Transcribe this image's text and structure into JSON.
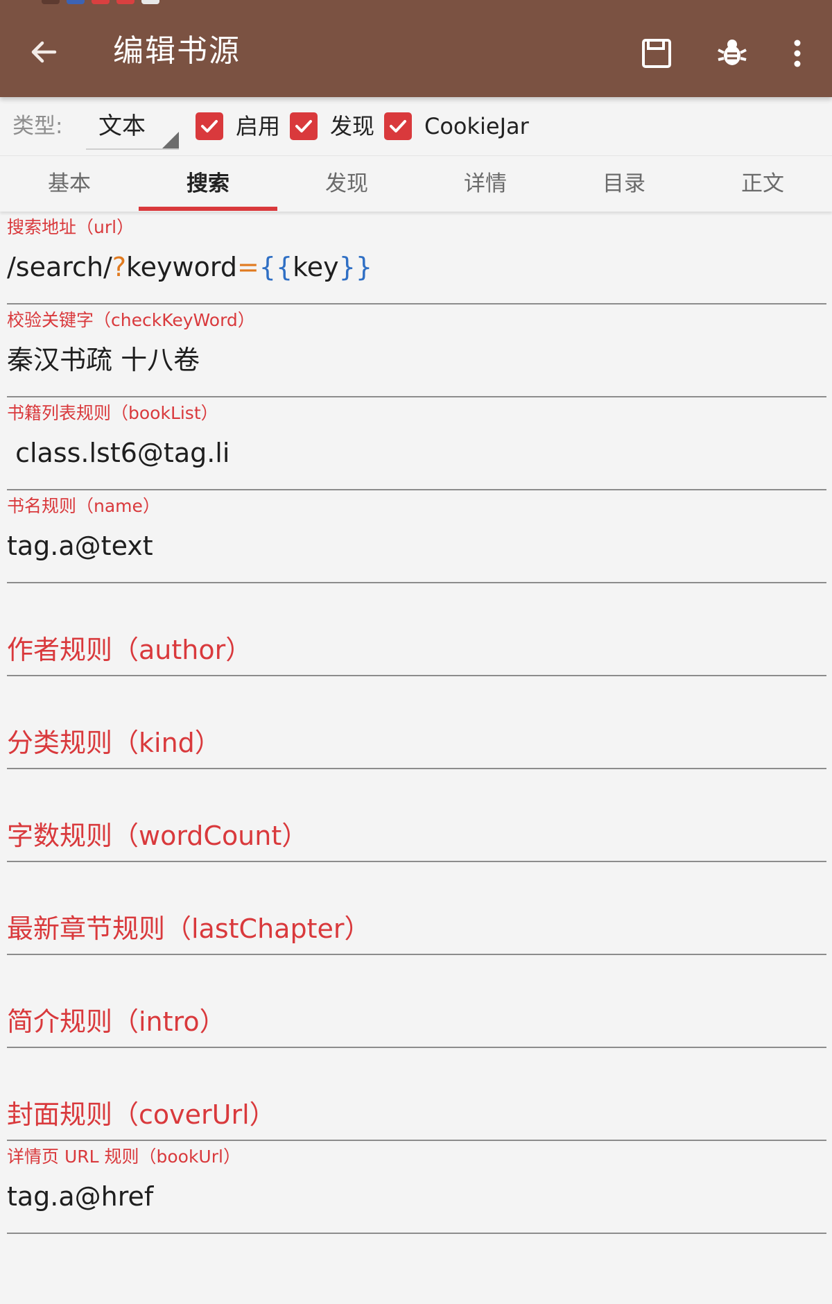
{
  "toolbar": {
    "title": "编辑书源",
    "icons": [
      "back-arrow-icon",
      "save-icon",
      "bug-icon",
      "more-vert-icon"
    ],
    "background": "#7b5242"
  },
  "options": {
    "type_label": "类型:",
    "type_value": "文本",
    "checkboxes": [
      {
        "label": "启用",
        "checked": true
      },
      {
        "label": "发现",
        "checked": true
      },
      {
        "label": "CookieJar",
        "checked": true
      }
    ]
  },
  "tabs": [
    {
      "label": "基本",
      "active": false
    },
    {
      "label": "搜索",
      "active": true
    },
    {
      "label": "发现",
      "active": false
    },
    {
      "label": "详情",
      "active": false
    },
    {
      "label": "目录",
      "active": false
    },
    {
      "label": "正文",
      "active": false
    }
  ],
  "fields": {
    "search_url": {
      "label": "搜索地址（url）",
      "value_parts": [
        "/search/",
        "?",
        "keyword",
        "=",
        "{{",
        "key",
        "}}"
      ]
    },
    "check_keyword": {
      "label": "校验关键字（checkKeyWord）",
      "value": "秦汉书疏 十八卷"
    },
    "book_list": {
      "label": "书籍列表规则（bookList）",
      "value": " class.lst6@tag.li"
    },
    "name": {
      "label": "书名规则（name）",
      "value": "tag.a@text"
    },
    "author": {
      "hint": "作者规则（author）"
    },
    "kind": {
      "hint": "分类规则（kind）"
    },
    "word_count": {
      "hint": "字数规则（wordCount）"
    },
    "last_chapter": {
      "hint": "最新章节规则（lastChapter）"
    },
    "intro": {
      "hint": "简介规则（intro）"
    },
    "cover_url": {
      "hint": "封面规则（coverUrl）"
    },
    "book_url": {
      "label": "详情页 URL 规则（bookUrl）",
      "value": "tag.a@href"
    }
  },
  "colors": {
    "accent": "#d9393c",
    "toolbar": "#7b5242",
    "background": "#f4f4f4"
  }
}
